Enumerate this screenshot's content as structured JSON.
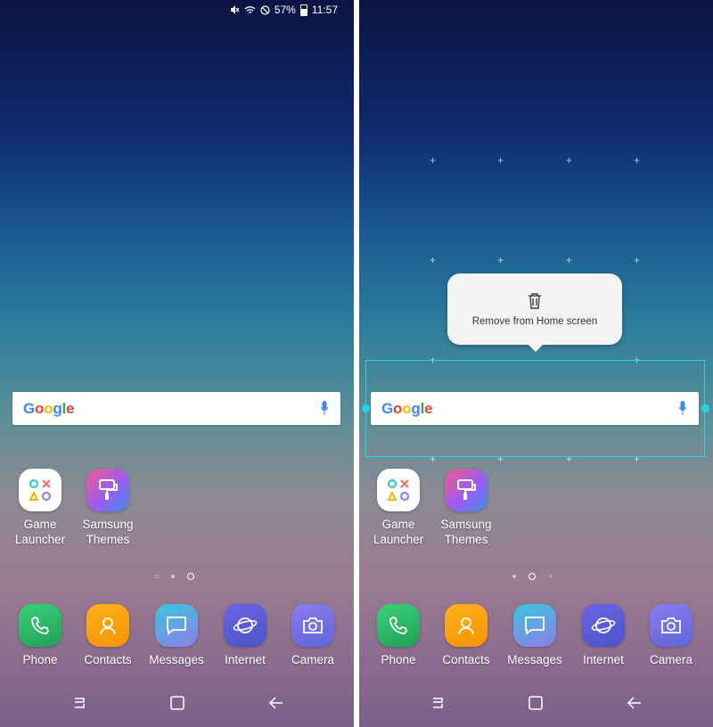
{
  "status_bar": {
    "battery": "57%",
    "time": "11:57",
    "icons": [
      "mute-icon",
      "wifi-icon",
      "do-not-disturb-icon",
      "battery-icon"
    ]
  },
  "search_widget": {
    "logo": "Google",
    "mic_icon": "mic-icon"
  },
  "apps": [
    {
      "id": "game-launcher",
      "label": "Game\nLauncher",
      "icon": "game-launcher-icon"
    },
    {
      "id": "samsung-themes",
      "label": "Samsung\nThemes",
      "icon": "brush-icon"
    }
  ],
  "dock": [
    {
      "id": "phone",
      "label": "Phone",
      "icon": "phone-icon",
      "color": "#27b35f"
    },
    {
      "id": "contacts",
      "label": "Contacts",
      "icon": "person-icon",
      "color": "#f5a000"
    },
    {
      "id": "messages",
      "label": "Messages",
      "icon": "message-icon",
      "color": "#27b0c9"
    },
    {
      "id": "internet",
      "label": "Internet",
      "icon": "planet-icon",
      "color": "#5b5fd8"
    },
    {
      "id": "camera",
      "label": "Camera",
      "icon": "camera-icon",
      "color": "#7b6fe6"
    }
  ],
  "context_menu": {
    "remove_label": "Remove from Home screen",
    "icon": "trash-icon"
  },
  "colors": {
    "selection": "#22d5e3"
  }
}
